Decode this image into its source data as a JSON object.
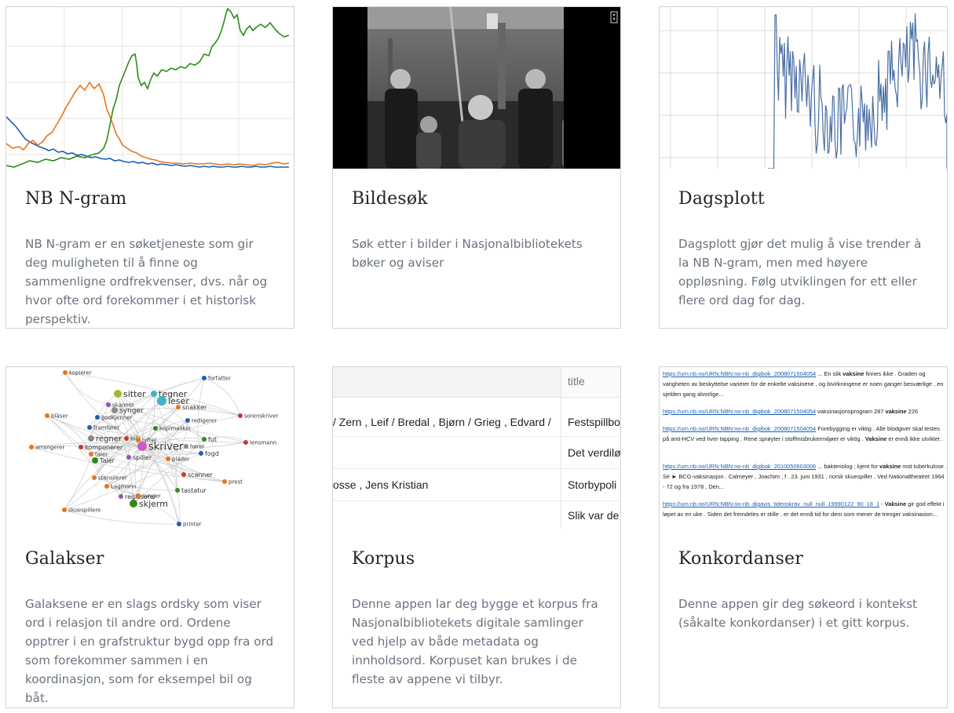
{
  "cards": [
    {
      "id": "ngram",
      "title": "NB N-gram",
      "description": "NB N-gram er en søketjeneste som gir deg muligheten til å finne og sammenligne ordfrekvenser, dvs. når og hvor ofte ord forekommer i et historisk perspektiv.",
      "thumbnail": {
        "kind": "line-chart",
        "series_colors": [
          "#2e8b1a",
          "#e8751a",
          "#1f5fb4"
        ]
      }
    },
    {
      "id": "bildesok",
      "title": "Bildesøk",
      "description": "Søk etter i bilder i Nasjonalbibliotekets bøker og aviser",
      "thumbnail": {
        "kind": "photo",
        "icon": "photo-icon"
      }
    },
    {
      "id": "dagsplott",
      "title": "Dagsplott",
      "description": "Dagsplott gjør det mulig å vise trender à la NB N-gram, men med høyere oppløsning. Følg utviklingen for ett eller flere ord dag for dag.",
      "thumbnail": {
        "kind": "line-chart",
        "series_colors": [
          "#4a6fa5"
        ]
      }
    },
    {
      "id": "galakser",
      "title": "Galakser",
      "description": "Galaksene er en slags ordsky som viser ord i relasjon til andre ord. Ordene opptrer i en grafstruktur bygd opp fra ord som forekommer sammen i en koordinasjon, som for eksempel bil og båt.",
      "thumbnail": {
        "kind": "network-graph",
        "nodes": [
          "kopierer",
          "forfatter",
          "sitter",
          "tegner",
          "leser",
          "skanner",
          "snakker",
          "synger",
          "godkjenner",
          "bläser",
          "redigerer",
          "sorenskriver",
          "framfører",
          "kopimaskin",
          "regner",
          "blår",
          "lytter",
          "fut",
          "lensmann",
          "arrangerer",
          "komponerer",
          "skriver",
          "hører",
          "taler",
          "fogd",
          "Taler",
          "spiller",
          "plader",
          "stensilerer",
          "scanner",
          "prest",
          "Lagmann",
          "regisserer",
          "tastatur",
          "synger",
          "skjerm",
          "skuespillere",
          "printer"
        ]
      }
    },
    {
      "id": "korpus",
      "title": "Korpus",
      "description": "Denne appen lar deg bygge et korpus fra Nasjonalbibliotekets digitale samlinger ved hjelp av både metadata og innholdsord. Korpuset kan brukes i de fleste av appene vi tilbyr.",
      "thumbnail": {
        "kind": "table",
        "header": "title",
        "rows": [
          {
            "authors": "/ Zern , Leif / Bredal , Bjørn / Grieg , Edvard /",
            "title": "Festspillbo"
          },
          {
            "authors": "",
            "title": "Det verdilø"
          },
          {
            "authors": "osse , Jens Kristian",
            "title": "Storbypoli"
          },
          {
            "authors": "",
            "title": "Slik var de"
          }
        ]
      }
    },
    {
      "id": "konkordanser",
      "title": "Konkordanser",
      "description": "Denne appen gir deg søkeord i kontekst (såkalte konkordanser) i et gitt korpus.",
      "thumbnail": {
        "kind": "concordance-list",
        "entries": [
          {
            "url": "https://urn.nb.no/URN:NBN:no-nb_digibok_2008071504054",
            "before": " ... En slik ",
            "keyword": "vaksine",
            "after": " finnes ikke . Graden og varigheten av beskyttelse varierer for de enkelte vaksinene , og bivirkningene er noen ganger besværlige , en sjelden gang alvorlige..."
          },
          {
            "url": "https://urn.nb.no/URN:NBN:no-nb_digibok_2008071504054",
            "before": " vaksinasjonsprogram 287 ",
            "keyword": "vaksine",
            "after": " 226"
          },
          {
            "url": "https://urn.nb.no/URN:NBN:no-nb_digibok_2008071504054",
            "before": " Forebygging er viktig . Alle blodgiver skal testes på anti-HCV ved hver tapping . Rene sprøyter i stoffmisbrukermiljøer er viktig . ",
            "keyword": "Vaksine",
            "after": " er ennå ikke utviklet ."
          },
          {
            "url": "https://urn.nb.no/URN:NBN:no-nb_digibok_2010050603006",
            "before": " ... bakteriolog ; kjent for ",
            "keyword": "vaksine",
            "after": " mot tuberkulose . Se ► BCG-vaksinasjon . Calmeyer , Joachim , f . 23. juni 1931 , norsk skuespiller . Ved Nationaltheatret 1964 - 72 og fra 1978 , Den..."
          },
          {
            "url": "https://urn.nb.no/URN:NBN:no-nb_digavis_tidenskrav_null_null_19990122_90_18_1",
            "before": " - ",
            "keyword": "Vaksine",
            "after": " gir god effekt i løpet av en uke . Siden det fremdeles er stille , er det ennå tid for dem som mener de trenger vaksinasion..."
          }
        ]
      }
    }
  ]
}
